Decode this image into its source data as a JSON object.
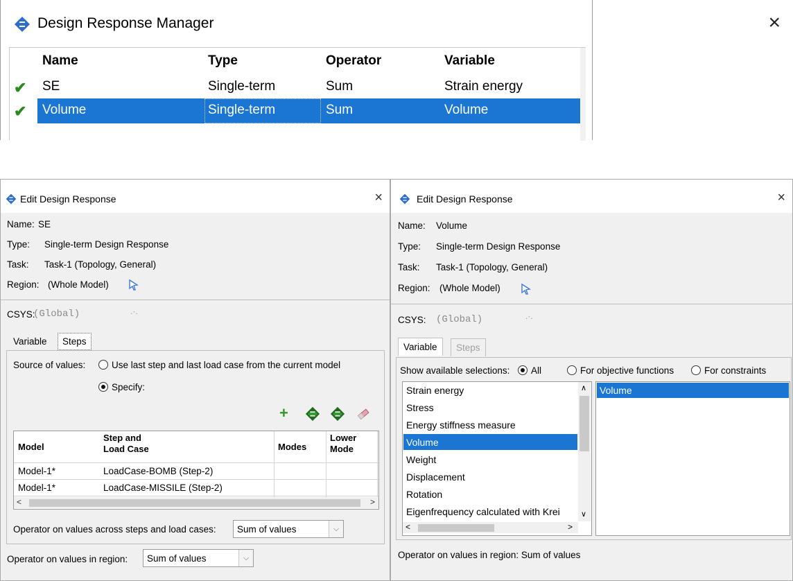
{
  "manager": {
    "title": "Design Response Manager",
    "columns": [
      "Name",
      "Type",
      "Operator",
      "Variable"
    ],
    "rows": [
      {
        "check": "✔",
        "name": "SE",
        "type": "Single-term",
        "operator": "Sum",
        "variable": "Strain energy",
        "selected": false
      },
      {
        "check": "✔",
        "name": "Volume",
        "type": "Single-term",
        "operator": "Sum",
        "variable": "Volume",
        "selected": true
      }
    ]
  },
  "edit_se": {
    "title": "Edit Design Response",
    "name_label": "Name:",
    "name_value": "SE",
    "type_label": "Type:",
    "type_value": "Single-term Design Response",
    "task_label": "Task:",
    "task_value": "Task-1 (Topology, General)",
    "region_label": "Region:",
    "region_value": "(Whole Model)",
    "csys_label": "CSYS:",
    "csys_value": "(Global)",
    "tabs": [
      "Variable",
      "Steps"
    ],
    "source_label": "Source of values:",
    "source_option_1": "Use last step and last load case from the current model",
    "source_option_2": "Specify:",
    "grid_headers": {
      "model": "Model",
      "step_line1": "Step and",
      "step_line2": "Load Case",
      "modes": "Modes",
      "lower_line1": "Lower",
      "lower_line2": "Mode"
    },
    "grid_rows": [
      {
        "model": "Model-1*",
        "step": "LoadCase-BOMB (Step-2)"
      },
      {
        "model": "Model-1*",
        "step": "LoadCase-MISSILE (Step-2)"
      }
    ],
    "steps_operator_label": "Operator on values across steps and load cases:",
    "steps_operator_value": "Sum of values",
    "region_operator_label": "Operator on values in region:",
    "region_operator_value": "Sum of values"
  },
  "edit_volume": {
    "title": "Edit Design Response",
    "name_label": "Name:",
    "name_value": "Volume",
    "type_label": "Type:",
    "type_value": "Single-term Design Response",
    "task_label": "Task:",
    "task_value": "Task-1 (Topology, General)",
    "region_label": "Region:",
    "region_value": "(Whole Model)",
    "csys_label": "CSYS:",
    "csys_value": "(Global)",
    "tabs": [
      "Variable",
      "Steps"
    ],
    "show_label": "Show available selections:",
    "show_options": [
      "All",
      "For objective functions",
      "For constraints"
    ],
    "variables": [
      "Strain energy",
      "Stress",
      "Energy stiffness measure",
      "Volume",
      "Weight",
      "Displacement",
      "Rotation",
      "Eigenfrequency calculated with Krei"
    ],
    "selected_variable": "Volume",
    "right_list": [
      "Volume"
    ],
    "region_operator_text": "Operator on values in region: Sum of values"
  },
  "colors": {
    "selection": "#1a76d2",
    "check": "#2a8a1e",
    "add_green": "#2f9a2a"
  }
}
